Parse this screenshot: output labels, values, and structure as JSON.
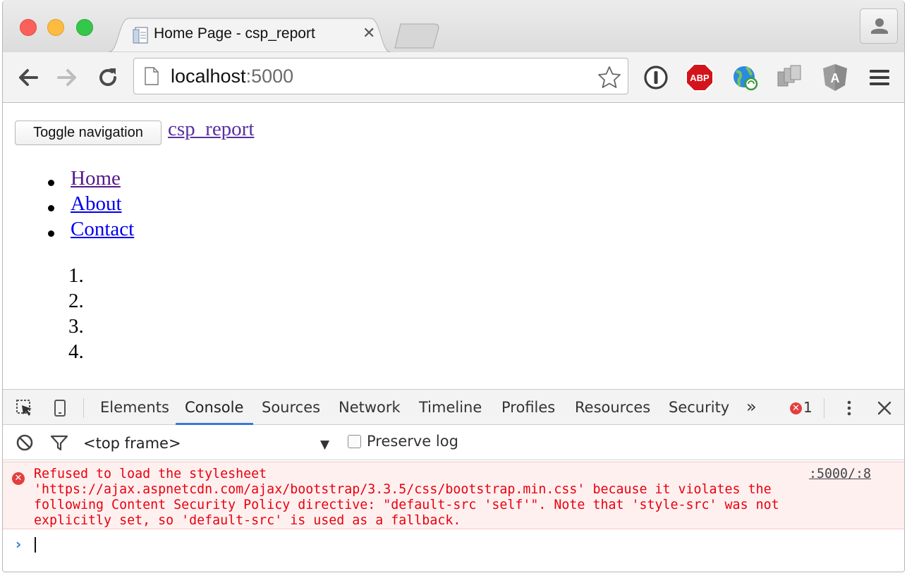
{
  "browser": {
    "tab_title": "Home Page - csp_report",
    "tab_close": "✕",
    "url_host": "localhost",
    "url_port": ":5000",
    "extensions": [
      "1password-icon",
      "adblock-plus-icon",
      "globe-sync-icon",
      "copy-icon",
      "angular-icon"
    ],
    "abp_label": "ABP",
    "angular_label": "A"
  },
  "page": {
    "toggle_label": "Toggle navigation",
    "brand": "csp_report",
    "nav_items": [
      "Home",
      "About",
      "Contact"
    ],
    "ordered_items": [
      "1.",
      "2.",
      "3.",
      "4."
    ],
    "visited_color": "#551a8b",
    "link_color": "#0000ee"
  },
  "devtools": {
    "tabs": [
      "Elements",
      "Console",
      "Sources",
      "Network",
      "Timeline",
      "Profiles",
      "Resources",
      "Security"
    ],
    "active_tab": "Console",
    "more_tabs": "»",
    "error_count": "1",
    "frame_selector": "<top frame>",
    "preserve_log": "Preserve log",
    "messages": [
      {
        "level": "error",
        "text": "Refused to load the stylesheet\n'https://ajax.aspnetcdn.com/ajax/bootstrap/3.3.5/css/bootstrap.min.css' because it violates the\nfollowing Content Security Policy directive: \"default-src 'self'\". Note that 'style-src' was not\nexplicitly set, so 'default-src' is used as a fallback.",
        "source": ":5000/:8"
      }
    ],
    "prompt": "›"
  },
  "colors": {
    "error_text": "#e8000d",
    "error_bg": "#fff0f0",
    "accent": "#3879d9"
  }
}
